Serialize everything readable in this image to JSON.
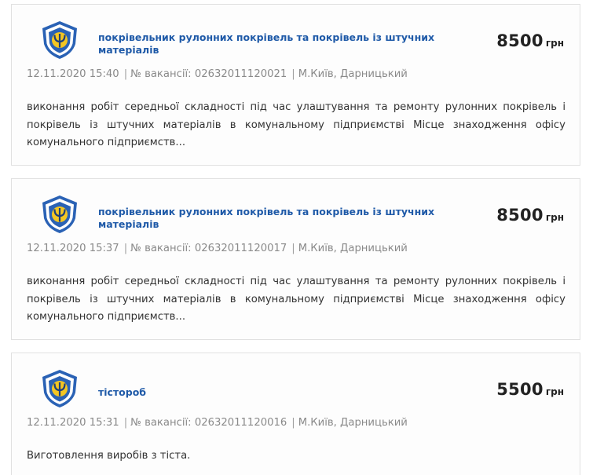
{
  "vacancies": [
    {
      "title": "покрівельник рулонних покрівель та покрівель із штучних матеріалів",
      "price": "8500",
      "currency": "грн",
      "date": "12.11.2020 15:40",
      "number_label": "№ вакансії:",
      "number": "02632011120021",
      "location": "М.Київ, Дарницький",
      "description": "виконання робіт середньої складності під час улаштування та ремонту рулонних покрівель і покрівель із штучних матеріалів в комунальному підприємстві Місце знаходження офісу комунального підприємств..."
    },
    {
      "title": "покрівельник рулонних покрівель та покрівель із штучних матеріалів",
      "price": "8500",
      "currency": "грн",
      "date": "12.11.2020 15:37",
      "number_label": "№ вакансії:",
      "number": "02632011120017",
      "location": "М.Київ, Дарницький",
      "description": "виконання робіт середньої складності під час улаштування та ремонту рулонних покрівель і покрівель із штучних матеріалів в комунальному підприємстві Місце знаходження офісу комунального підприємств..."
    },
    {
      "title": "тістороб",
      "price": "5500",
      "currency": "грн",
      "date": "12.11.2020 15:31",
      "number_label": "№ вакансії:",
      "number": "02632011120016",
      "location": "М.Київ, Дарницький",
      "description": "Виготовлення виробів з тіста."
    }
  ],
  "colors": {
    "title_link": "#1f5aa8",
    "logo_blue": "#2a62b5",
    "logo_yellow": "#f3c623"
  },
  "icons": {
    "logo": "employment-service-shield-logo"
  }
}
